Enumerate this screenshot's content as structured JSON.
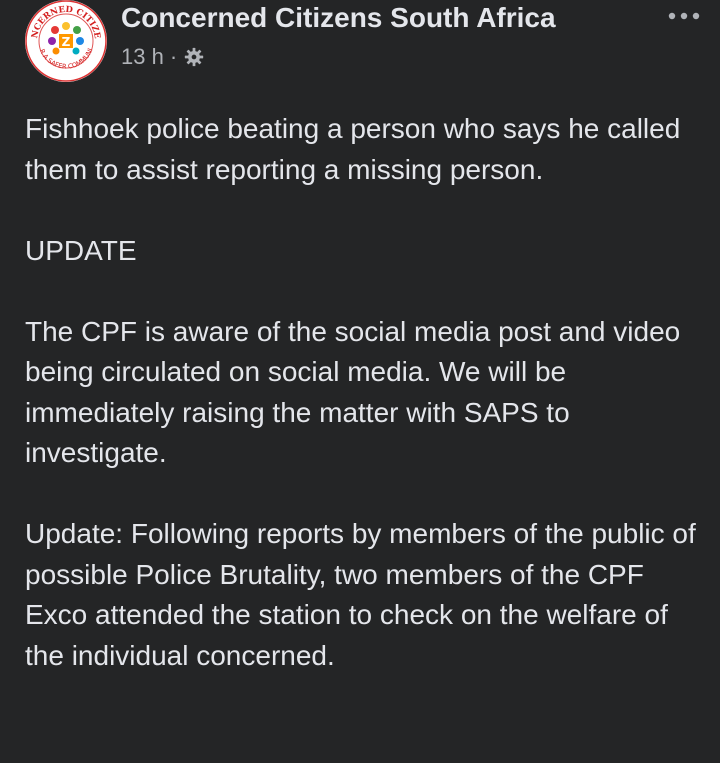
{
  "post": {
    "page_name": "Concerned Citizens South Africa",
    "timestamp": "13 h",
    "separator": "·",
    "privacy_icon": "gear-icon",
    "more_icon": "more-options-icon",
    "avatar": {
      "logo_text_top": "CONCERNED CITIZENS",
      "logo_text_bottom": "FOR A SAFER COMMUNITY",
      "logo_letter": "Z"
    },
    "paragraphs": [
      "Fishhoek police beating a person who says he called them to assist reporting a missing person.",
      "UPDATE",
      "The CPF is aware of the social media post and video being circulated on social media. We will be immediately raising the matter with SAPS to investigate.",
      "Update: Following reports by members of the public of possible Police Brutality, two members of the CPF Exco attended the station to check on the welfare of the individual concerned."
    ]
  },
  "colors": {
    "background": "#242526",
    "primary_text": "#e4e6eb",
    "secondary_text": "#b0b3b8"
  }
}
